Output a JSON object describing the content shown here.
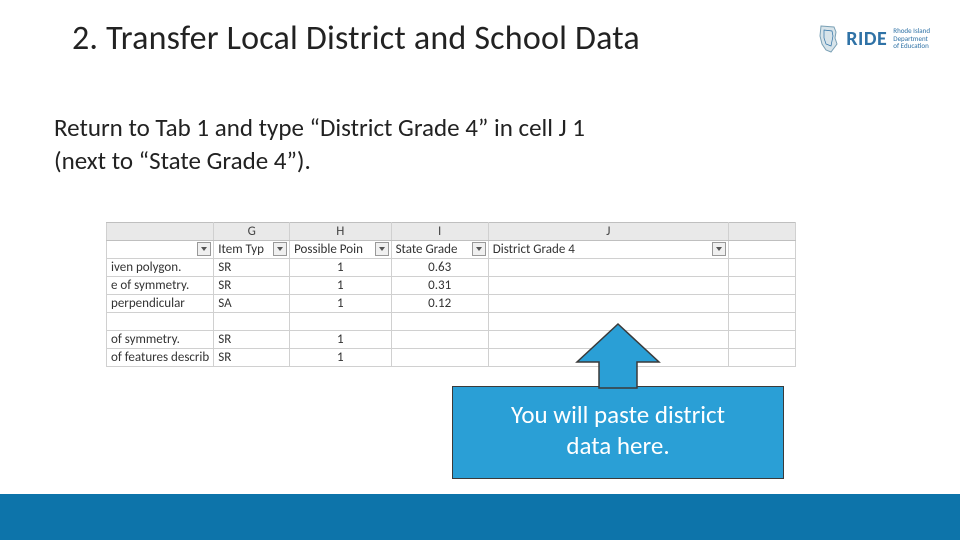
{
  "title": "2.   Transfer Local District and School Data",
  "logo": {
    "text": "RIDE",
    "sub1": "Rhode Island",
    "sub2": "Department",
    "sub3": "of Education"
  },
  "body_line1": "Return to Tab 1 and type “District Grade 4”  in cell J 1",
  "body_line2": "(next to “State Grade 4”).",
  "excel": {
    "col_letters": [
      "",
      "G",
      "H",
      "I",
      "J",
      ""
    ],
    "headers": [
      "",
      "Item Typ",
      "Possible Poin",
      "State Grade",
      "District Grade 4",
      ""
    ],
    "rows": [
      {
        "f_text": "iven polygon.",
        "item_type": "SR",
        "points": "1",
        "state": "0.63",
        "district": ""
      },
      {
        "f_text": "e of symmetry.",
        "item_type": "SR",
        "points": "1",
        "state": "0.31",
        "district": ""
      },
      {
        "f_text": "perpendicular",
        "item_type": "SA",
        "points": "1",
        "state": "0.12",
        "district": ""
      }
    ],
    "rows2": [
      {
        "f_text": "of symmetry.",
        "item_type": "SR",
        "points": "1",
        "state": "",
        "district": ""
      },
      {
        "f_text": "of features describ",
        "item_type": "SR",
        "points": "1",
        "state": "",
        "district": ""
      }
    ]
  },
  "callout": {
    "line1": "You will paste district",
    "line2": "data here."
  },
  "colors": {
    "accent": "#2a9fd6",
    "footer": "#0d74aa"
  }
}
